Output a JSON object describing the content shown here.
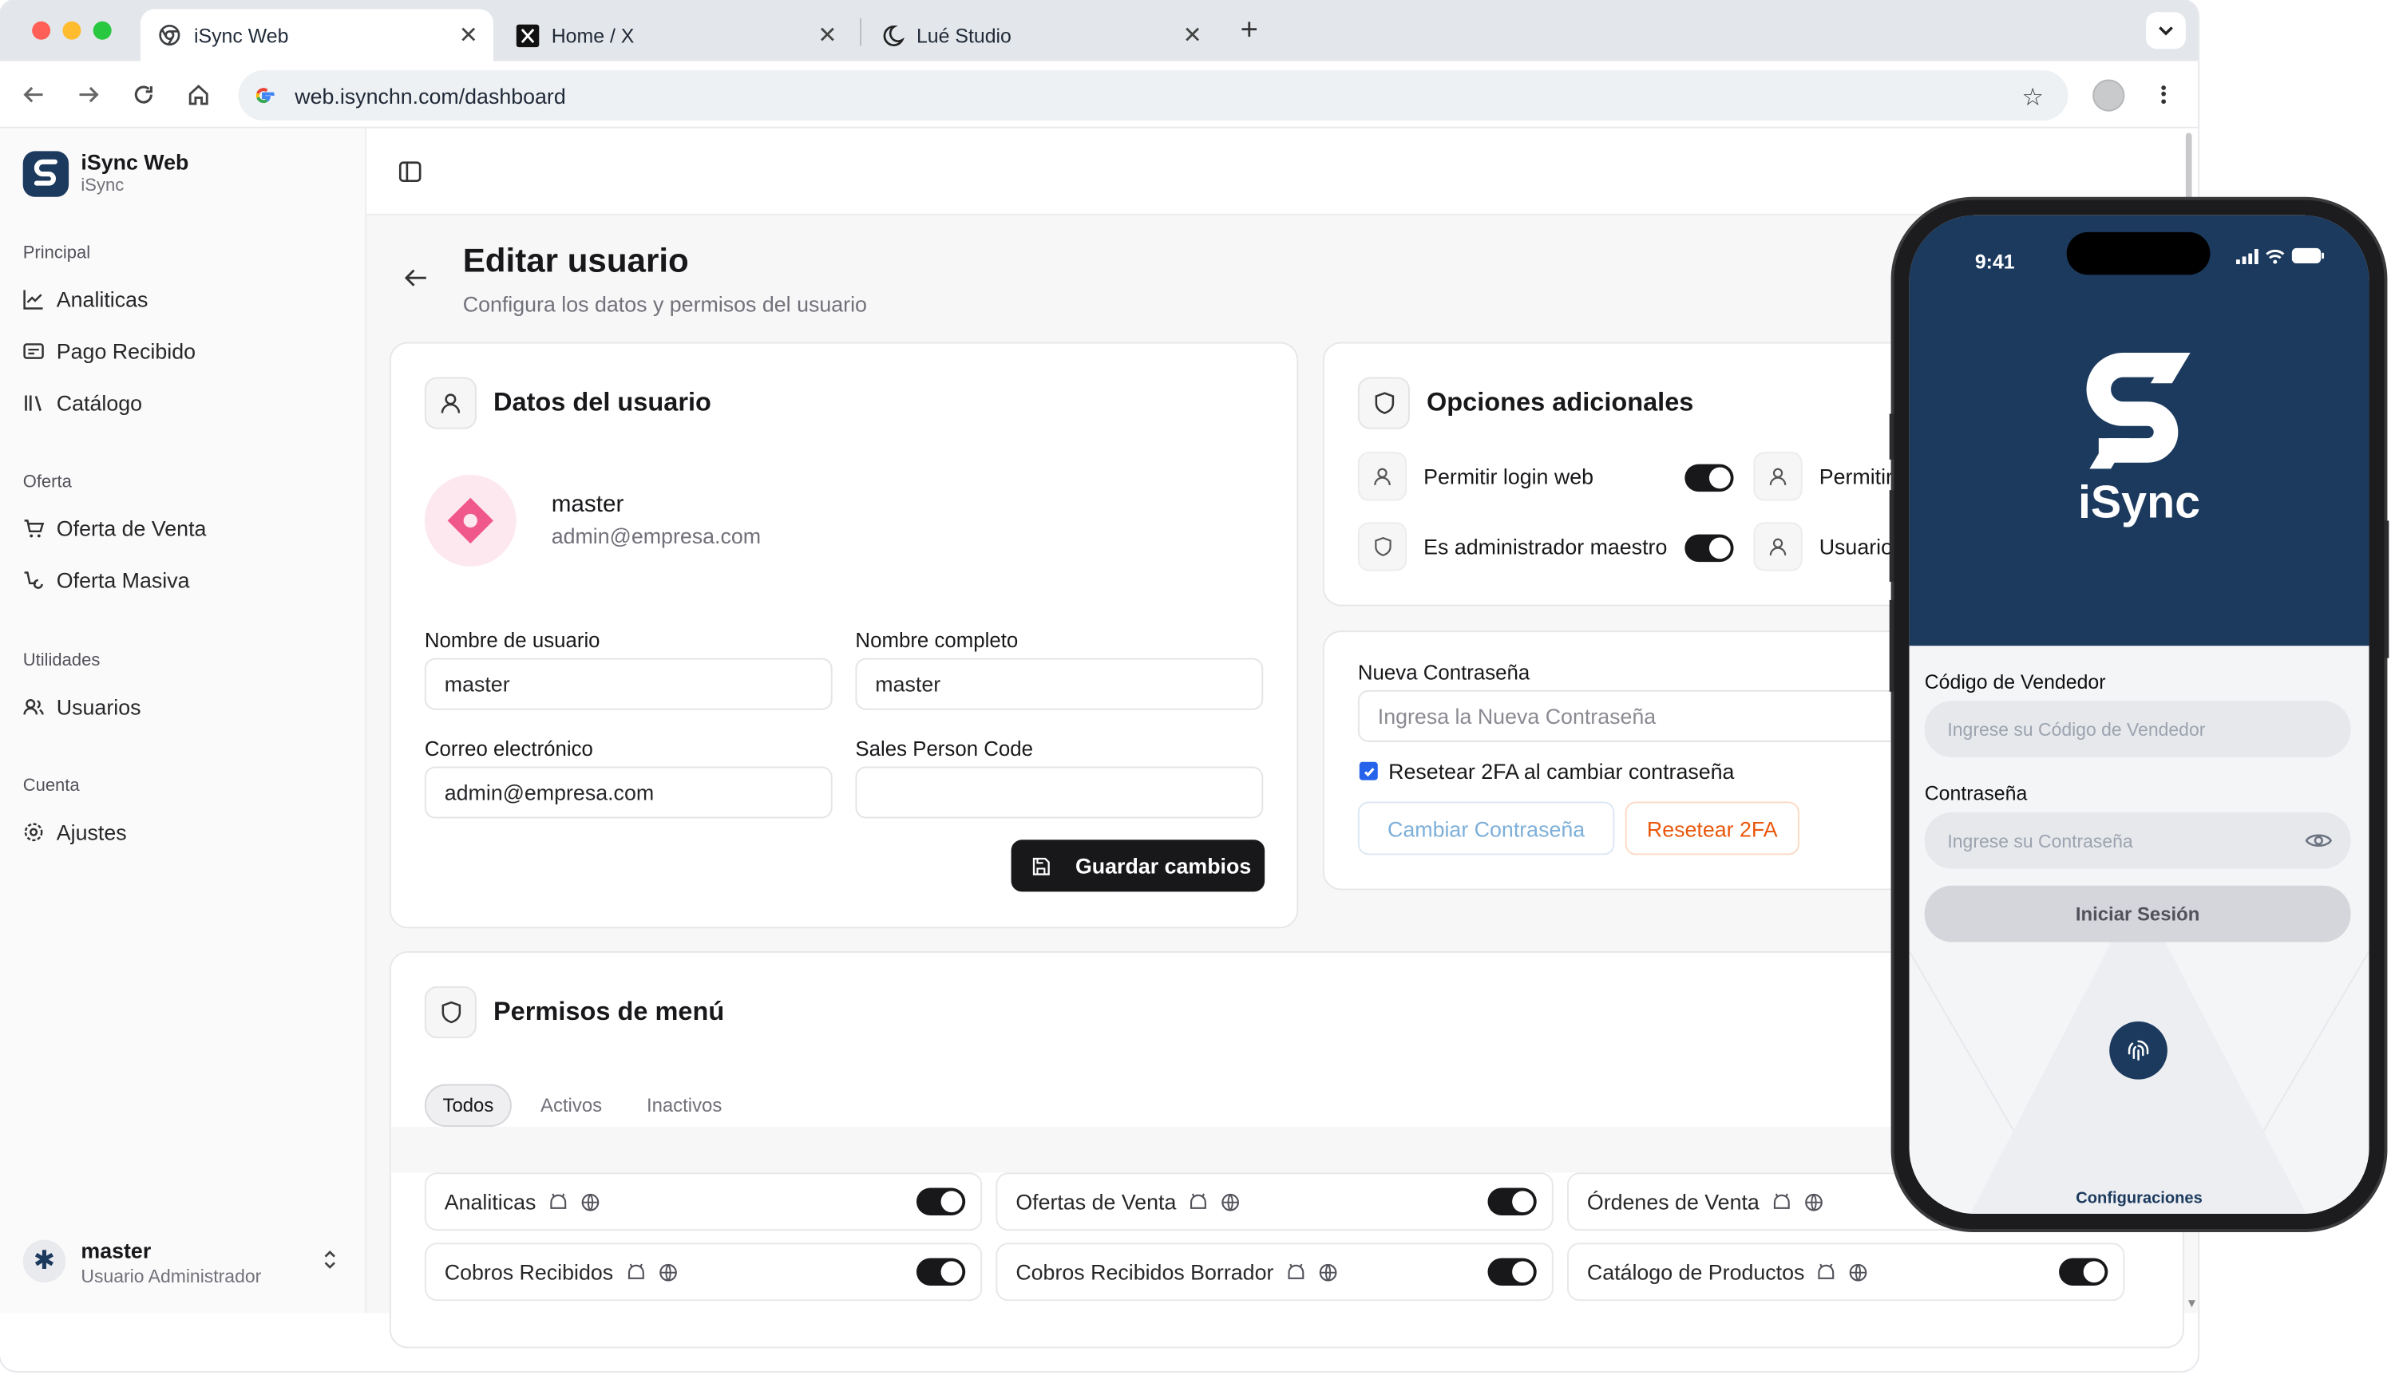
{
  "browser": {
    "tabs": [
      {
        "title": "iSync Web"
      },
      {
        "title": "Home / X"
      },
      {
        "title": "Lué Studio"
      }
    ],
    "url": "web.isynchn.com/dashboard"
  },
  "sidebar": {
    "app_name": "iSync Web",
    "app_sub": "iSync",
    "sections": [
      {
        "title": "Principal",
        "items": [
          "Analiticas",
          "Pago Recibido",
          "Catálogo"
        ]
      },
      {
        "title": "Oferta",
        "items": [
          "Oferta de Venta",
          "Oferta Masiva"
        ]
      },
      {
        "title": "Utilidades",
        "items": [
          "Usuarios"
        ]
      },
      {
        "title": "Cuenta",
        "items": [
          "Ajustes"
        ]
      }
    ],
    "user": {
      "name": "master",
      "role": "Usuario Administrador"
    }
  },
  "page": {
    "title": "Editar usuario",
    "subtitle": "Configura los datos y permisos del usuario"
  },
  "user_card": {
    "title": "Datos del usuario",
    "name": "master",
    "email": "admin@empresa.com",
    "fields": {
      "username_label": "Nombre de usuario",
      "username_value": "master",
      "fullname_label": "Nombre completo",
      "fullname_value": "master",
      "email_label": "Correo electrónico",
      "email_value": "admin@empresa.com",
      "spcode_label": "Sales Person Code",
      "spcode_value": ""
    },
    "save_label": "Guardar cambios"
  },
  "options_card": {
    "title": "Opciones adicionales",
    "options": [
      {
        "label": "Permitir login web",
        "on": true
      },
      {
        "label": "Es administrador maestro",
        "on": true
      },
      {
        "label": "Permitir"
      },
      {
        "label": "Usuario"
      }
    ]
  },
  "password_card": {
    "label": "Nueva Contraseña",
    "placeholder": "Ingresa la Nueva Contraseña",
    "checkbox_label": "Resetear 2FA al cambiar contraseña",
    "checkbox_checked": true,
    "change_label": "Cambiar Contraseña",
    "reset_label": "Resetear 2FA"
  },
  "perms_card": {
    "title": "Permisos de menú",
    "filters": [
      "Todos",
      "Activos",
      "Inactivos"
    ],
    "active_filter": "Todos",
    "items": [
      {
        "label": "Analiticas",
        "on": true
      },
      {
        "label": "Ofertas de Venta",
        "on": true
      },
      {
        "label": "Órdenes de Venta"
      },
      {
        "label": "Cobros Recibidos",
        "on": true
      },
      {
        "label": "Cobros Recibidos Borrador",
        "on": true
      },
      {
        "label": "Catálogo de Productos",
        "on": true
      }
    ]
  },
  "phone": {
    "time": "9:41",
    "brand": "iSync",
    "vendor_label": "Código de Vendedor",
    "vendor_placeholder": "Ingrese su Código de Vendedor",
    "password_label": "Contraseña",
    "password_placeholder": "Ingrese su Contraseña",
    "login_label": "Iniciar Sesión",
    "settings_label": "Configuraciones"
  },
  "colors": {
    "brand_navy": "#1c3a5e",
    "primary_button": "#18181b",
    "reset_orange": "#ea580c",
    "change_blue_muted": "#7dafd9"
  }
}
